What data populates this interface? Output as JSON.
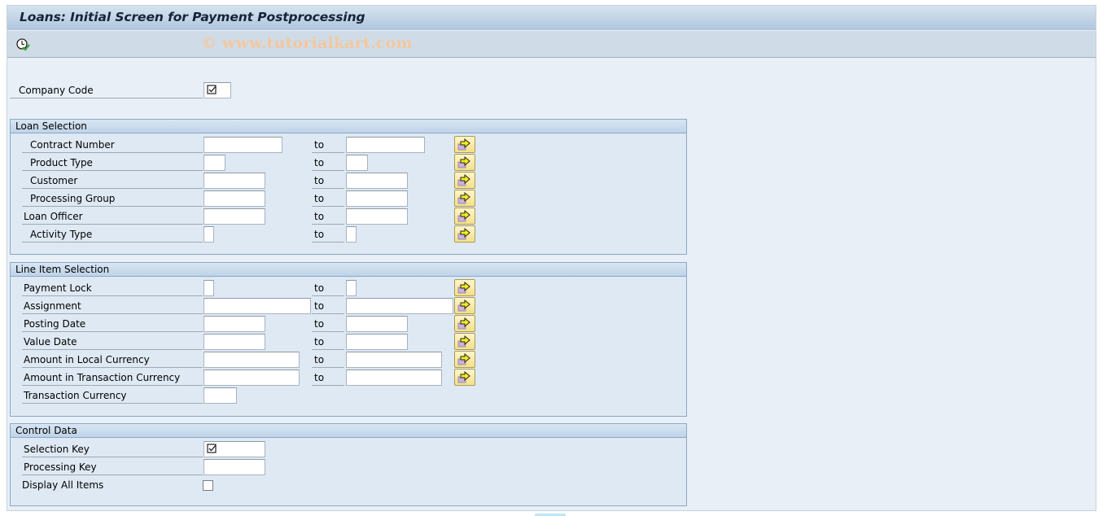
{
  "window": {
    "title": "Loans: Initial Screen for Payment Postprocessing"
  },
  "toolbar": {
    "execute_icon": "execute-clock-check-icon",
    "watermark": "© www.tutorialkart.com"
  },
  "header_fields": {
    "company_code": {
      "label": "Company Code",
      "value": "",
      "required_icon": "required-checkbox-icon"
    }
  },
  "loan_selection": {
    "title": "Loan Selection",
    "rows": [
      {
        "label": "Contract Number",
        "from": "",
        "to_label": "to",
        "to": ""
      },
      {
        "label": "Product Type",
        "from": "",
        "to_label": "to",
        "to": ""
      },
      {
        "label": "Customer",
        "from": "",
        "to_label": "to",
        "to": ""
      },
      {
        "label": "Processing Group",
        "from": "",
        "to_label": "to",
        "to": ""
      },
      {
        "label": "Loan Officer",
        "from": "",
        "to_label": "to",
        "to": ""
      },
      {
        "label": "Activity Type",
        "from": "",
        "to_label": "to",
        "to": ""
      }
    ]
  },
  "line_item_selection": {
    "title": "Line Item Selection",
    "rows": [
      {
        "label": "Payment Lock",
        "from": "",
        "to_label": "to",
        "to": ""
      },
      {
        "label": "Assignment",
        "from": "",
        "to_label": "to",
        "to": ""
      },
      {
        "label": "Posting Date",
        "from": "",
        "to_label": "to",
        "to": ""
      },
      {
        "label": "Value Date",
        "from": "",
        "to_label": "to",
        "to": ""
      },
      {
        "label": "Amount in Local Currency",
        "from": "",
        "to_label": "to",
        "to": ""
      },
      {
        "label": "Amount in Transaction Currency",
        "from": "",
        "to_label": "to",
        "to": ""
      }
    ],
    "transaction_currency": {
      "label": "Transaction Currency",
      "value": ""
    }
  },
  "control_data": {
    "title": "Control Data",
    "selection_key": {
      "label": "Selection Key",
      "value": "",
      "required_icon": "required-checkbox-icon"
    },
    "processing_key": {
      "label": "Processing Key",
      "value": ""
    },
    "display_all_items": {
      "label": "Display All Items",
      "checked": false
    }
  },
  "colors": {
    "title_text": "#16243a",
    "watermark": "#f2c8a0",
    "group_border": "#8aa8c9",
    "background": "#e8eff7"
  }
}
